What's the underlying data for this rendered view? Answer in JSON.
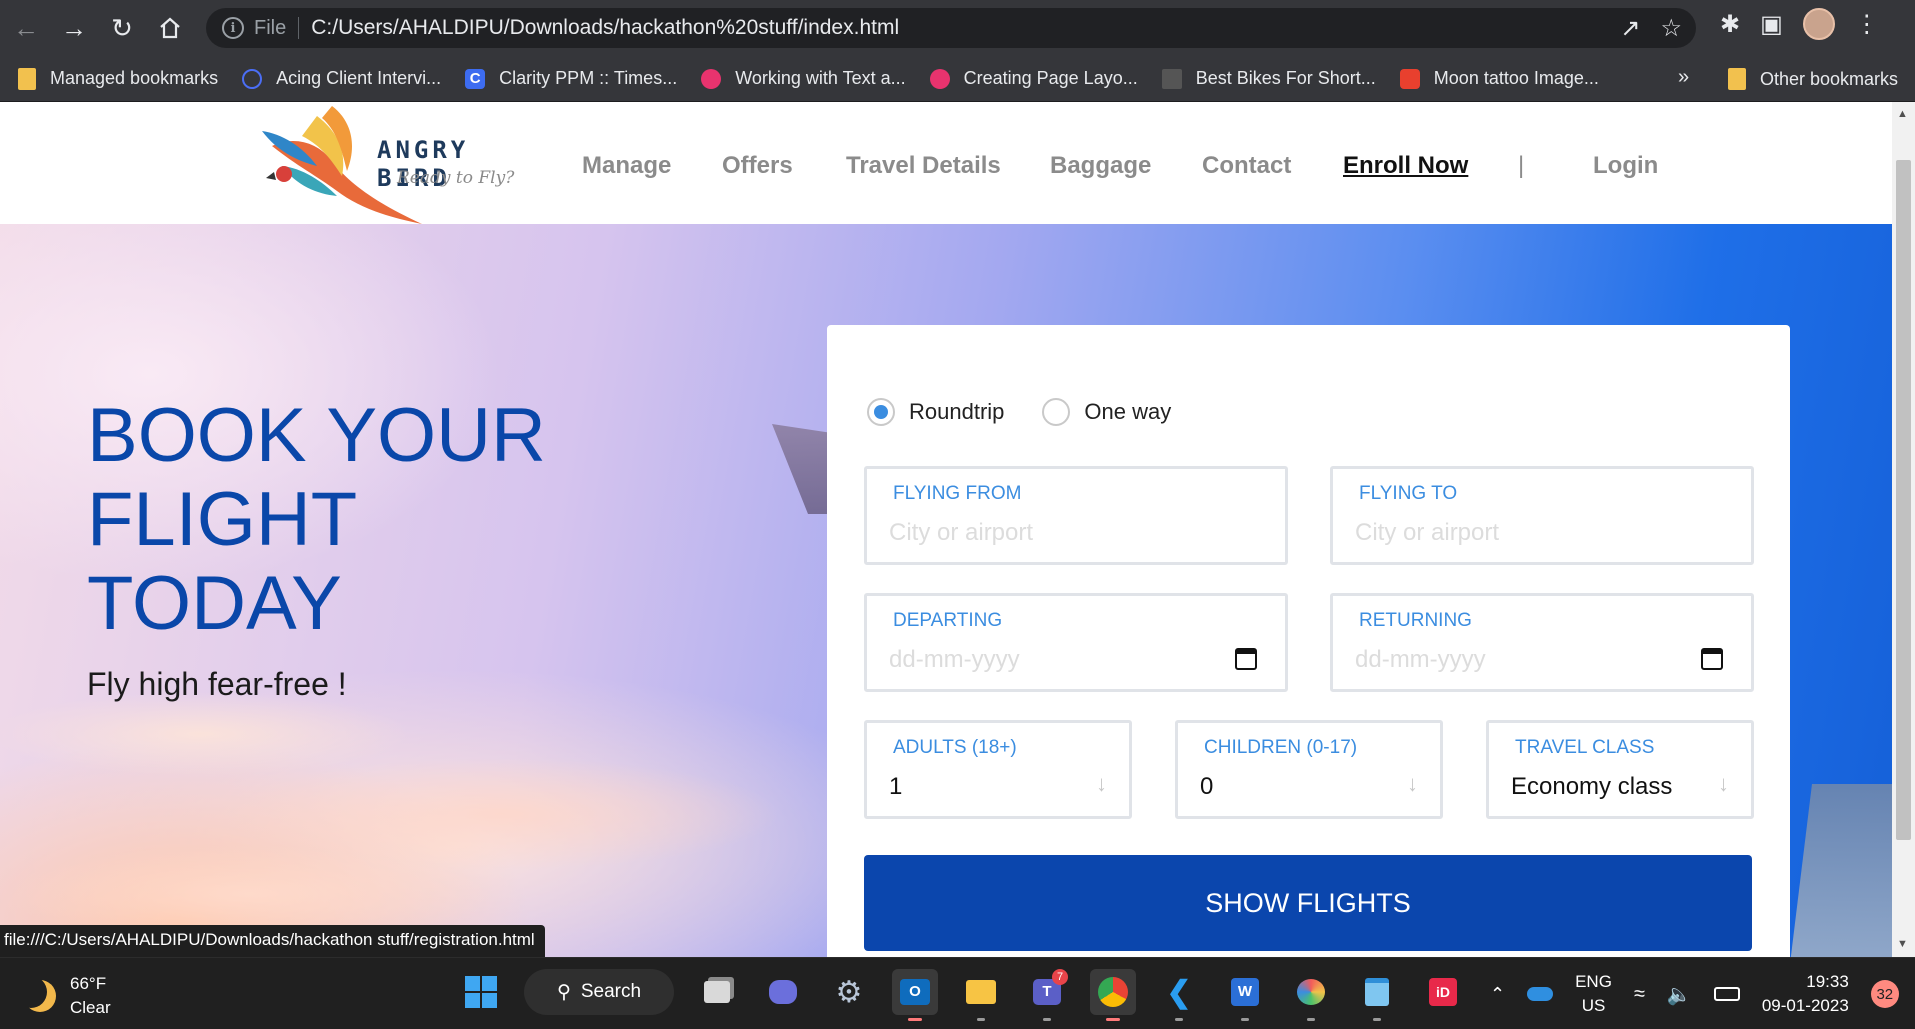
{
  "browser": {
    "url_scheme": "File",
    "url": "C:/Users/AHALDIPU/Downloads/hackathon%20stuff/index.html",
    "bookmarks": [
      {
        "label": "Managed bookmarks",
        "icon": "folder-icon"
      },
      {
        "label": "Acing Client Intervi...",
        "icon": "bookmark-icon"
      },
      {
        "label": "Clarity PPM :: Times...",
        "icon": "clarity-icon"
      },
      {
        "label": "Working with Text a...",
        "icon": "play-icon"
      },
      {
        "label": "Creating Page Layo...",
        "icon": "play-icon"
      },
      {
        "label": "Best Bikes For Short...",
        "icon": "bike-icon"
      },
      {
        "label": "Moon tattoo Image...",
        "icon": "image-icon"
      }
    ],
    "bookmarks_more": "»",
    "other_bookmarks": "Other bookmarks",
    "status_url": "file:///C:/Users/AHALDIPU/Downloads/hackathon stuff/registration.html"
  },
  "site": {
    "logo_title": "ANGRY BIRD",
    "logo_tagline": "Ready to Fly?",
    "nav": [
      "Manage",
      "Offers",
      "Travel Details",
      "Baggage",
      "Contact",
      "Enroll Now",
      "|",
      "Login"
    ]
  },
  "hero": {
    "title_line1": "BOOK YOUR",
    "title_line2": "FLIGHT",
    "title_line3": "TODAY",
    "subtitle": "Fly high fear-free !"
  },
  "booking": {
    "trip_types": [
      {
        "label": "Roundtrip",
        "checked": true
      },
      {
        "label": "One way",
        "checked": false
      }
    ],
    "flying_from": {
      "label": "FLYING FROM",
      "placeholder": "City or airport"
    },
    "flying_to": {
      "label": "FLYING TO",
      "placeholder": "City or airport"
    },
    "departing": {
      "label": "DEPARTING",
      "placeholder": "dd-mm-yyyy"
    },
    "returning": {
      "label": "RETURNING",
      "placeholder": "dd-mm-yyyy"
    },
    "adults": {
      "label": "ADULTS (18+)",
      "value": "1"
    },
    "children": {
      "label": "CHILDREN (0-17)",
      "value": "0"
    },
    "travel_class": {
      "label": "TRAVEL CLASS",
      "value": "Economy class"
    },
    "submit_label": "SHOW FLIGHTS",
    "accent_color": "#0b46ad",
    "label_color": "#3b8de0"
  },
  "taskbar": {
    "temperature": "66°F",
    "condition": "Clear",
    "search_label": "Search",
    "teams_badge": "7",
    "lang_line1": "ENG",
    "lang_line2": "US",
    "time": "19:33",
    "date": "09-01-2023",
    "notification_count": "32"
  }
}
